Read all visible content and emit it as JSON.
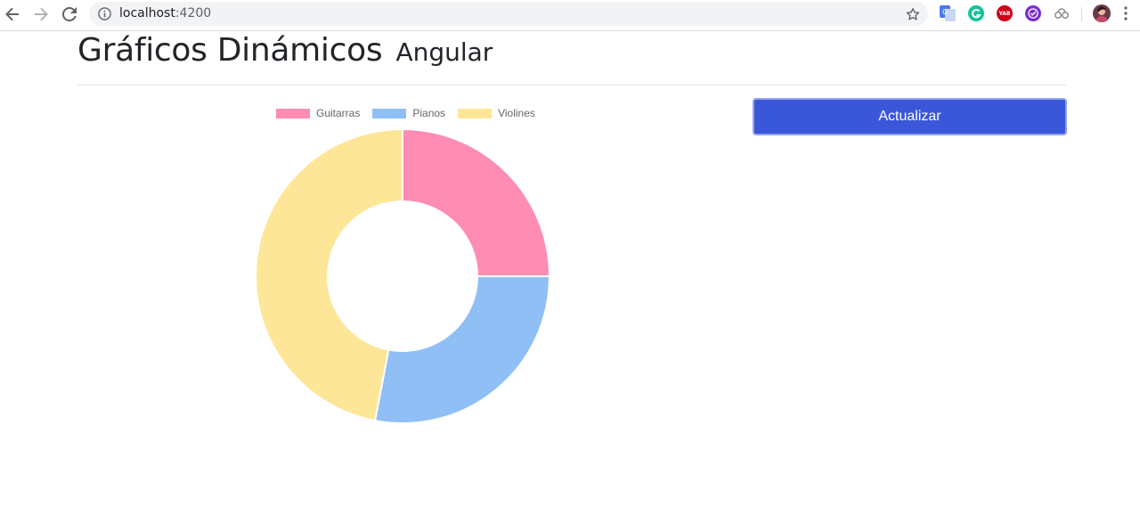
{
  "browser": {
    "url_host": "localhost",
    "url_port": ":4200",
    "icons": {
      "back": "arrow-left-icon",
      "forward": "arrow-right-icon",
      "reload": "reload-icon",
      "info": "info-icon",
      "bookmark": "star-icon"
    },
    "extensions": [
      {
        "name": "google-translate-icon",
        "color": "#4a78f0"
      },
      {
        "name": "grammarly-icon",
        "color": "#15c39a"
      },
      {
        "name": "yab-icon",
        "color": "#d0021b",
        "text": "YAB"
      },
      {
        "name": "purple-check-icon",
        "color": "#7b2fd1"
      },
      {
        "name": "cloud-link-icon",
        "color": "#8a8a8a"
      },
      {
        "name": "profile-avatar-icon",
        "color": "#6b3a4a"
      },
      {
        "name": "menu-more-icon",
        "color": "#5f6368"
      }
    ]
  },
  "page": {
    "title": "Gráficos Dinámicos",
    "subtitle": "Angular",
    "update_button": "Actualizar"
  },
  "chart_data": {
    "type": "doughnut",
    "categories": [
      "Guitarras",
      "Pianos",
      "Violines"
    ],
    "values": [
      25,
      28,
      47
    ],
    "colors": [
      "#ff8cb2",
      "#8fbff4",
      "#fee699"
    ],
    "legend": "top"
  }
}
